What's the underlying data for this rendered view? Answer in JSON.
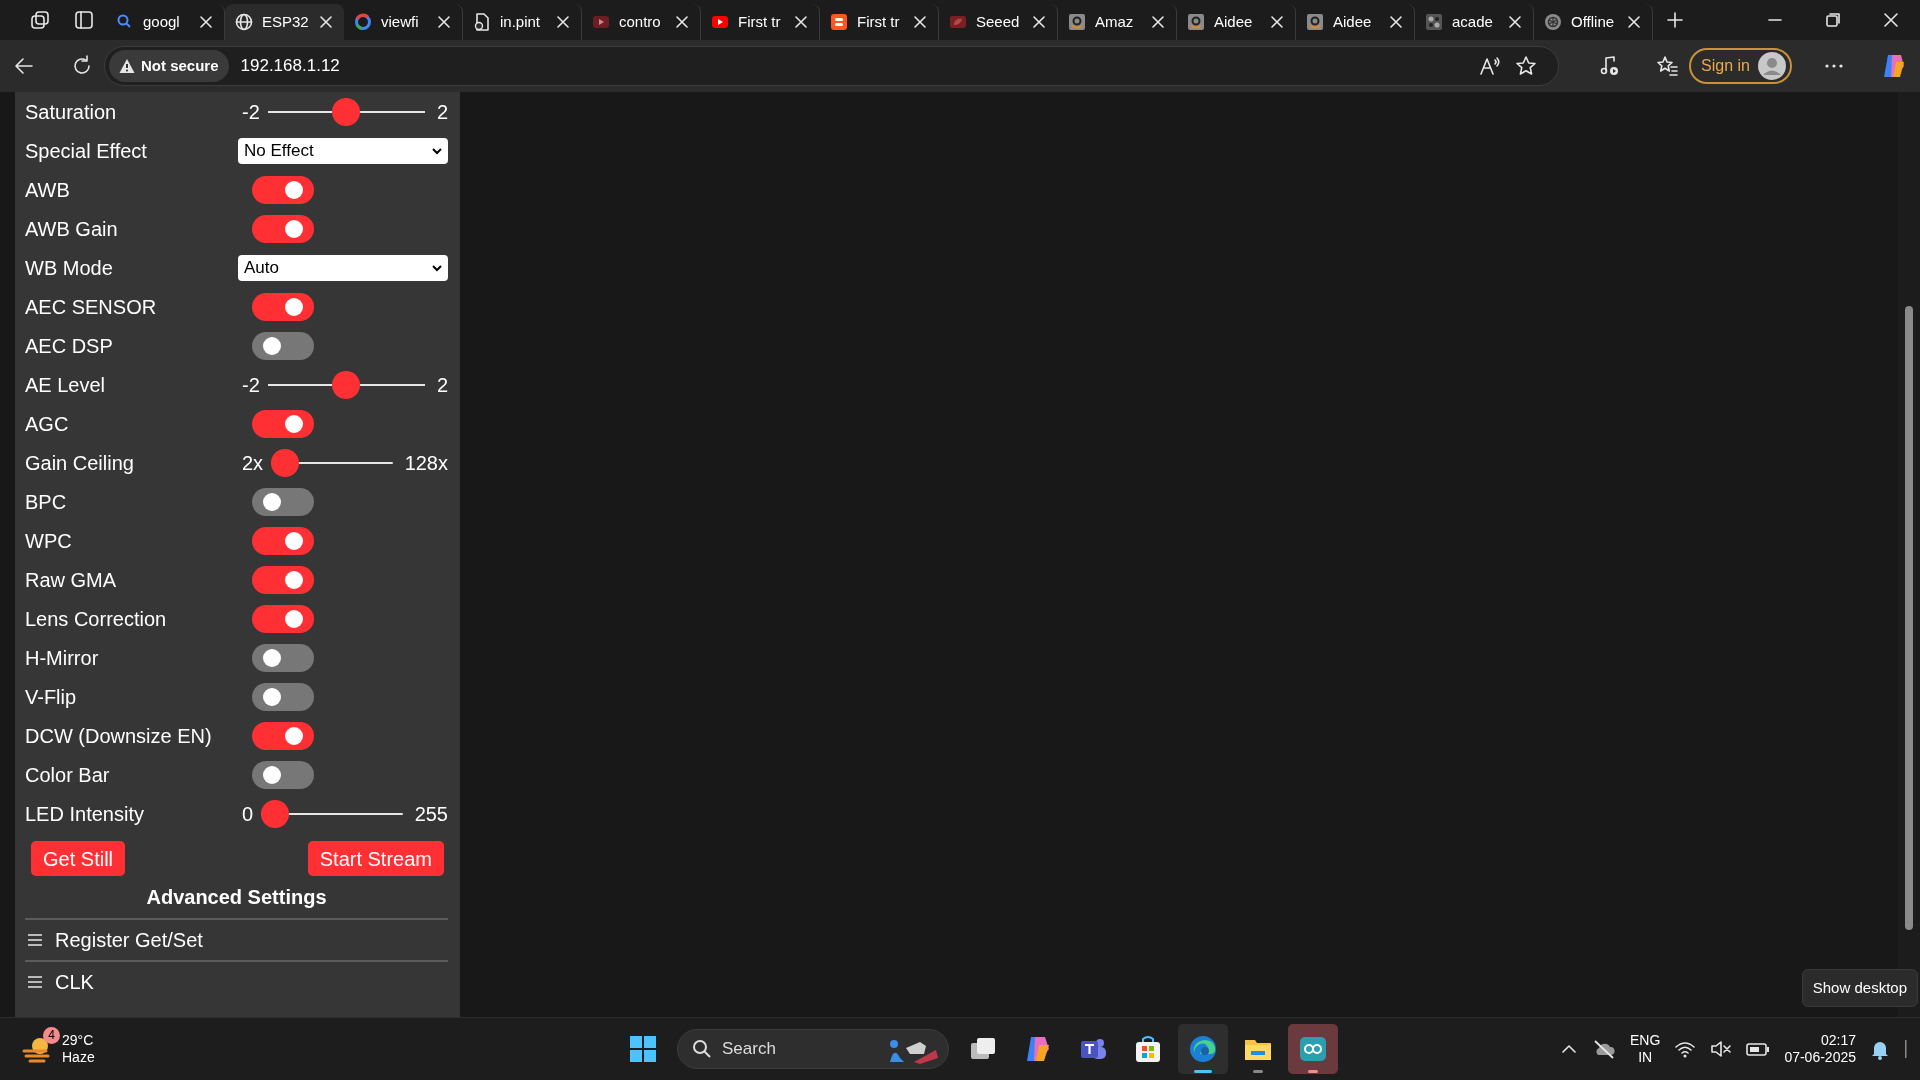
{
  "browser": {
    "tabs": [
      {
        "title": "googl",
        "kind": "search",
        "selected": false
      },
      {
        "title": "ESP32",
        "kind": "globe",
        "selected": true
      },
      {
        "title": "viewfi",
        "kind": "ring",
        "selected": false
      },
      {
        "title": "in.pint",
        "kind": "document",
        "selected": false
      },
      {
        "title": "contro",
        "kind": "play-dark",
        "selected": false
      },
      {
        "title": "First tr",
        "kind": "play",
        "selected": false
      },
      {
        "title": "First tr",
        "kind": "orange",
        "selected": false
      },
      {
        "title": "Seeed",
        "kind": "maroon",
        "selected": false
      },
      {
        "title": "Amaz",
        "kind": "grey",
        "selected": false
      },
      {
        "title": "Aidee",
        "kind": "grey",
        "selected": false
      },
      {
        "title": "Aidee",
        "kind": "grey",
        "selected": false
      },
      {
        "title": "acade",
        "kind": "dots",
        "selected": false
      },
      {
        "title": "Offline",
        "kind": "knot",
        "selected": false
      }
    ],
    "address_bar": {
      "security": "Not secure",
      "url": "192.168.1.12"
    },
    "sign_in": "Sign in"
  },
  "settings": [
    {
      "kind": "slider",
      "label": "Saturation",
      "min": "-2",
      "max": "2",
      "level": 0.5
    },
    {
      "kind": "select",
      "label": "Special Effect",
      "value": "No Effect"
    },
    {
      "kind": "toggle",
      "label": "AWB",
      "on": true
    },
    {
      "kind": "toggle",
      "label": "AWB Gain",
      "on": true
    },
    {
      "kind": "select",
      "label": "WB Mode",
      "value": "Auto"
    },
    {
      "kind": "toggle",
      "label": "AEC SENSOR",
      "on": true
    },
    {
      "kind": "toggle",
      "label": "AEC DSP",
      "on": false
    },
    {
      "kind": "slider",
      "label": "AE Level",
      "min": "-2",
      "max": "2",
      "level": 0.5
    },
    {
      "kind": "toggle",
      "label": "AGC",
      "on": true
    },
    {
      "kind": "slider",
      "label": "Gain Ceiling",
      "min": "2x",
      "max": "128x",
      "level": 0
    },
    {
      "kind": "toggle",
      "label": "BPC",
      "on": false
    },
    {
      "kind": "toggle",
      "label": "WPC",
      "on": true
    },
    {
      "kind": "toggle",
      "label": "Raw GMA",
      "on": true
    },
    {
      "kind": "toggle",
      "label": "Lens Correction",
      "on": true
    },
    {
      "kind": "toggle",
      "label": "H-Mirror",
      "on": false
    },
    {
      "kind": "toggle",
      "label": "V-Flip",
      "on": false
    },
    {
      "kind": "toggle",
      "label": "DCW (Downsize EN)",
      "on": true
    },
    {
      "kind": "toggle",
      "label": "Color Bar",
      "on": false
    },
    {
      "kind": "slider",
      "label": "LED Intensity",
      "min": "0",
      "max": "255",
      "level": 0
    }
  ],
  "buttons": [
    "Get Still",
    "Start Stream"
  ],
  "advanced_title": "Advanced Settings",
  "sections": [
    "Register Get/Set",
    "CLK"
  ],
  "tooltip": "Show desktop",
  "taskbar": {
    "weather": {
      "badge": "4",
      "temperature": "29°C",
      "condition": "Haze"
    },
    "search": "Search",
    "language": [
      "ENG",
      "IN"
    ],
    "time": "02:17",
    "date": "07-06-2025"
  }
}
